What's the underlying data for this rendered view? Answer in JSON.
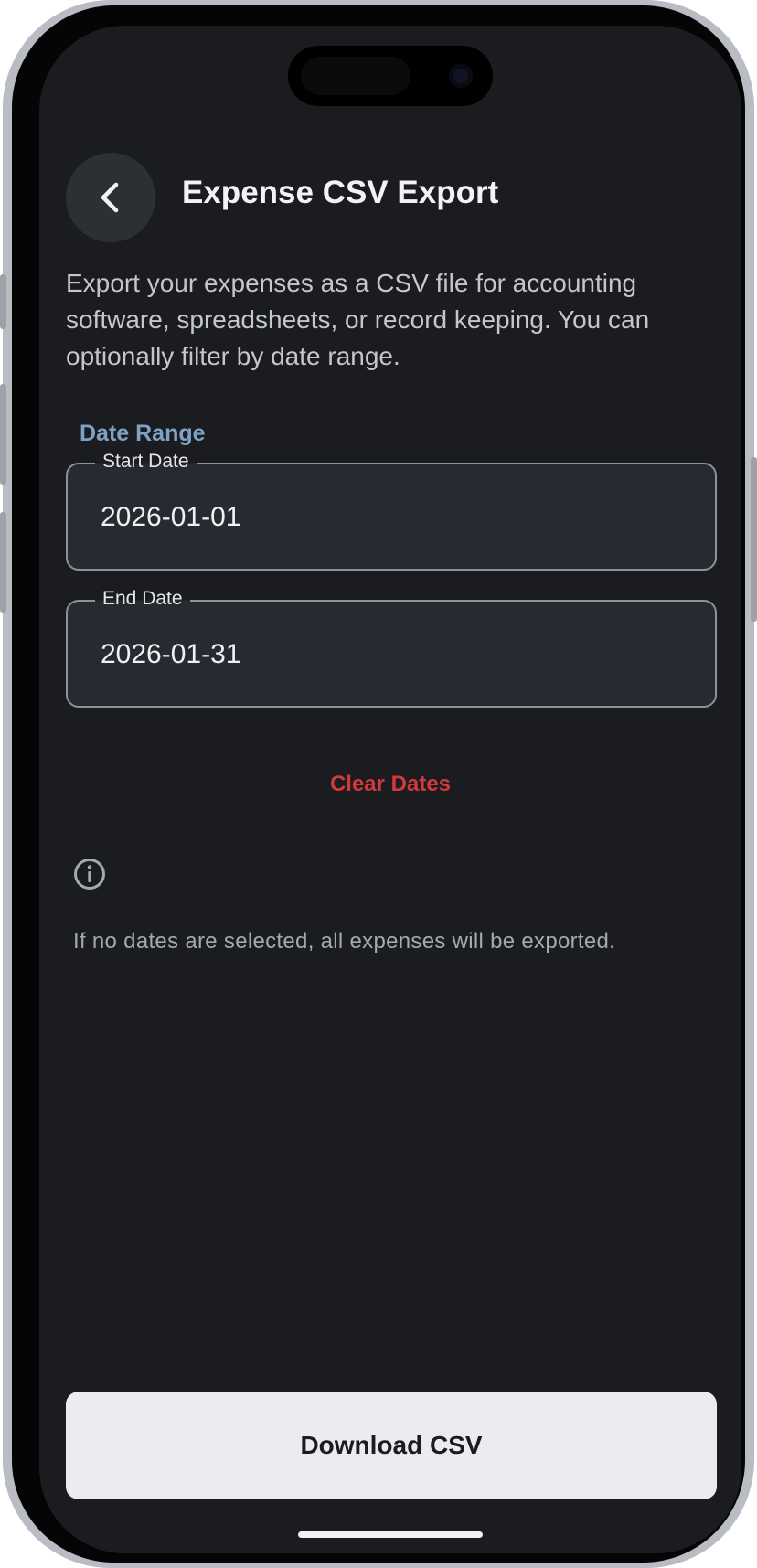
{
  "header": {
    "back_icon": "chevron-left-icon",
    "title": "Expense CSV Export"
  },
  "description": "Export your expenses as a CSV file for accounting software, spreadsheets, or record keeping. You can optionally filter by date range.",
  "date_range": {
    "section_title": "Date Range",
    "start": {
      "label": "Start Date",
      "value": "2026-01-01"
    },
    "end": {
      "label": "End Date",
      "value": "2026-01-31"
    },
    "clear_label": "Clear Dates"
  },
  "info": {
    "icon": "info-icon",
    "text": "If no dates are selected, all expenses will be exported."
  },
  "download": {
    "label": "Download CSV"
  },
  "colors": {
    "background": "#1a1c20",
    "accent": "#7ea2c6",
    "danger": "#d2393b",
    "field_background": "#282a31",
    "button_background": "#ececf0"
  }
}
